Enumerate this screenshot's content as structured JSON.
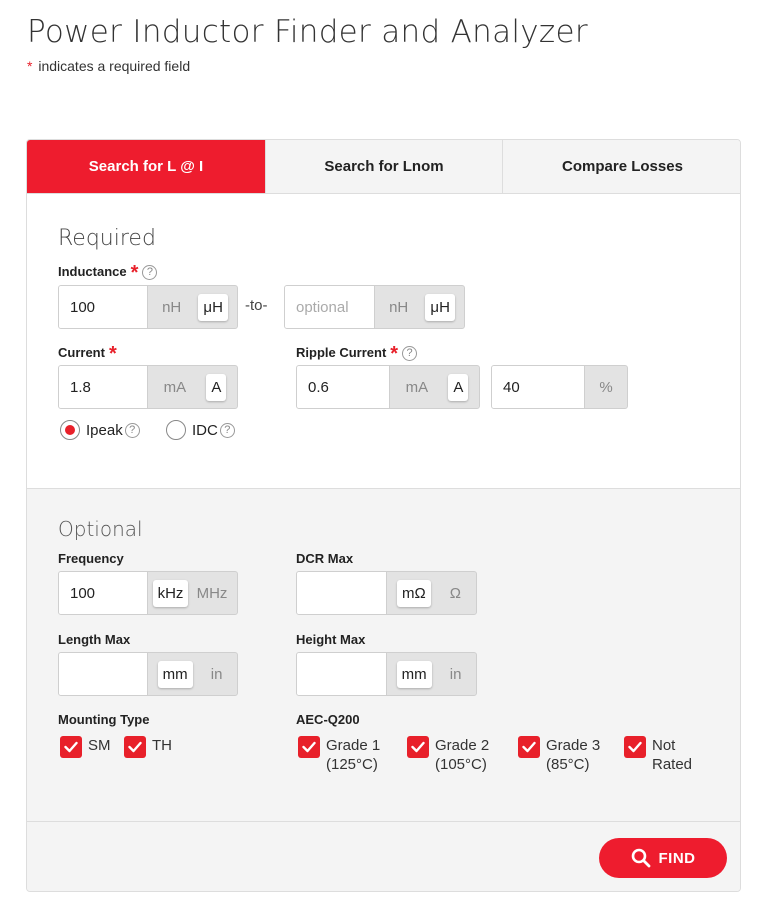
{
  "header": {
    "title": "Power Inductor Finder and Analyzer",
    "required_star": "*",
    "required_note": "indicates a required field"
  },
  "tabs": [
    {
      "label": "Search for L @ I",
      "active": true
    },
    {
      "label": "Search for Lnom",
      "active": false
    },
    {
      "label": "Compare Losses",
      "active": false
    }
  ],
  "required": {
    "title": "Required",
    "inductance": {
      "label": "Inductance",
      "value": "100",
      "units": [
        "nH",
        "μH"
      ],
      "selected_unit": "μH",
      "separator": "-to-",
      "max_placeholder": "optional",
      "max_units": [
        "nH",
        "μH"
      ],
      "max_selected_unit": "μH"
    },
    "current": {
      "label": "Current",
      "value": "1.8",
      "units": [
        "mA",
        "A"
      ],
      "selected_unit": "A"
    },
    "ripple": {
      "label": "Ripple Current",
      "value": "0.6",
      "units": [
        "mA",
        "A"
      ],
      "selected_unit": "A",
      "percent_value": "40",
      "percent_unit": "%"
    },
    "current_type": {
      "options": [
        "Ipeak",
        "IDC"
      ],
      "selected": "Ipeak"
    },
    "star": "*",
    "help": "?"
  },
  "optional": {
    "title": "Optional",
    "frequency": {
      "label": "Frequency",
      "value": "100",
      "units": [
        "kHz",
        "MHz"
      ],
      "selected_unit": "kHz"
    },
    "dcr_max": {
      "label": "DCR Max",
      "value": "",
      "units": [
        "mΩ",
        "Ω"
      ],
      "selected_unit": "mΩ"
    },
    "length_max": {
      "label": "Length Max",
      "value": "",
      "units": [
        "mm",
        "in"
      ],
      "selected_unit": "mm"
    },
    "height_max": {
      "label": "Height Max",
      "value": "",
      "units": [
        "mm",
        "in"
      ],
      "selected_unit": "mm"
    },
    "mounting_type": {
      "label": "Mounting Type",
      "options": [
        "SM",
        "TH"
      ],
      "checked": [
        true,
        true
      ]
    },
    "aec_q200": {
      "label": "AEC-Q200",
      "options": [
        {
          "line1": "Grade 1",
          "line2": "(125°C)"
        },
        {
          "line1": "Grade 2",
          "line2": "(105°C)"
        },
        {
          "line1": "Grade 3",
          "line2": "(85°C)"
        },
        {
          "line1": "Not",
          "line2": "Rated"
        }
      ],
      "checked": [
        true,
        true,
        true,
        true
      ]
    }
  },
  "footer": {
    "find_label": "FIND"
  },
  "colors": {
    "accent": "#ee1c2e",
    "section_bg": "#f4f4f4"
  }
}
